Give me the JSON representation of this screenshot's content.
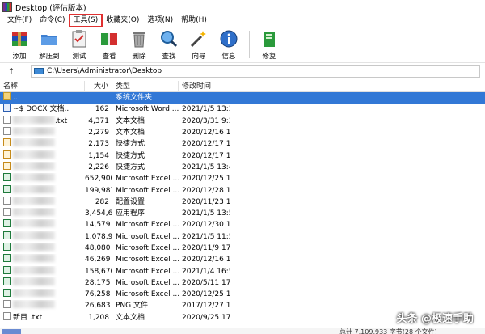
{
  "window": {
    "title": "Desktop (评估版本)"
  },
  "menu": [
    {
      "label": "文件(F)"
    },
    {
      "label": "命令(C)"
    },
    {
      "label": "工具(S)",
      "highlighted": true
    },
    {
      "label": "收藏夹(O)"
    },
    {
      "label": "选项(N)"
    },
    {
      "label": "帮助(H)"
    }
  ],
  "toolbar": {
    "buttons": [
      {
        "label": "添加",
        "icon": "add-archive-icon"
      },
      {
        "label": "解压到",
        "icon": "extract-folder-icon"
      },
      {
        "label": "测试",
        "icon": "test-clipboard-icon"
      },
      {
        "label": "查看",
        "icon": "view-book-icon"
      },
      {
        "label": "删除",
        "icon": "trash-icon"
      },
      {
        "label": "查找",
        "icon": "magnifier-icon"
      },
      {
        "label": "向导",
        "icon": "wizard-wand-icon"
      },
      {
        "label": "信息",
        "icon": "info-icon"
      },
      {
        "label": "修复",
        "icon": "repair-book-icon"
      }
    ]
  },
  "address": {
    "path": "C:\\Users\\Administrator\\Desktop",
    "up_glyph": "↑"
  },
  "list": {
    "headers": {
      "name": "名称",
      "size": "大小",
      "type": "类型",
      "date": "修改时间"
    },
    "rows": [
      {
        "name": "..",
        "size": "",
        "type": "系统文件夹",
        "date": "",
        "selected": true,
        "icon": "dir"
      },
      {
        "name": "~$ DOCX 文档...",
        "size": "162",
        "type": "Microsoft Word ...",
        "date": "2021/1/5 13:37",
        "icon": "doc"
      },
      {
        "name": ".txt",
        "size": "4,371",
        "type": "文本文档",
        "date": "2020/3/31 9:31",
        "icon": "txt",
        "blurred": true
      },
      {
        "name": "",
        "size": "2,279",
        "type": "文本文档",
        "date": "2020/12/16 1...",
        "icon": "txt",
        "blurred": true
      },
      {
        "name": "",
        "size": "2,173",
        "type": "快捷方式",
        "date": "2020/12/17 1...",
        "icon": "lnk",
        "blurred": true
      },
      {
        "name": "",
        "size": "1,154",
        "type": "快捷方式",
        "date": "2020/12/17 1...",
        "icon": "lnk",
        "blurred": true
      },
      {
        "name": "",
        "size": "2,226",
        "type": "快捷方式",
        "date": "2021/1/5 13:47",
        "icon": "lnk",
        "blurred": true
      },
      {
        "name": "",
        "size": "652,900",
        "type": "Microsoft Excel ...",
        "date": "2020/12/25 1...",
        "icon": "xls",
        "blurred": true
      },
      {
        "name": "",
        "size": "199,987",
        "type": "Microsoft Excel ...",
        "date": "2020/12/28 1...",
        "icon": "xls",
        "blurred": true
      },
      {
        "name": "",
        "size": "282",
        "type": "配置设置",
        "date": "2020/11/23 1...",
        "icon": "txt",
        "blurred": true
      },
      {
        "name": "",
        "size": "3,454,608",
        "type": "应用程序",
        "date": "2021/1/5 13:51",
        "icon": "txt",
        "blurred": true
      },
      {
        "name": "",
        "size": "14,579",
        "type": "Microsoft Excel ...",
        "date": "2020/12/30 1...",
        "icon": "xls",
        "blurred": true
      },
      {
        "name": "",
        "size": "1,078,959",
        "type": "Microsoft Excel ...",
        "date": "2021/1/5 11:53",
        "icon": "xls",
        "blurred": true
      },
      {
        "name": "",
        "size": "48,080",
        "type": "Microsoft Excel ...",
        "date": "2020/11/9 17...",
        "icon": "xls",
        "blurred": true
      },
      {
        "name": "",
        "size": "46,269",
        "type": "Microsoft Excel ...",
        "date": "2020/12/16 1...",
        "icon": "xls",
        "blurred": true
      },
      {
        "name": "",
        "size": "158,676",
        "type": "Microsoft Excel ...",
        "date": "2021/1/4 16:59",
        "icon": "xls",
        "blurred": true
      },
      {
        "name": "",
        "size": "28,175",
        "type": "Microsoft Excel ...",
        "date": "2020/5/11 17...",
        "icon": "xls",
        "blurred": true
      },
      {
        "name": "",
        "size": "76,258",
        "type": "Microsoft Excel ...",
        "date": "2020/12/25 1...",
        "icon": "xls",
        "blurred": true
      },
      {
        "name": "",
        "size": "26,683",
        "type": "PNG 文件",
        "date": "2017/12/27 1...",
        "icon": "txt",
        "blurred": true
      },
      {
        "name": "新目 .txt",
        "size": "1,208",
        "type": "文本文档",
        "date": "2020/9/25 17...",
        "icon": "txt"
      }
    ]
  },
  "status": {
    "right": "总计 7,109,933 字节(28 个文件)"
  },
  "watermark": "头条 @极速手助"
}
